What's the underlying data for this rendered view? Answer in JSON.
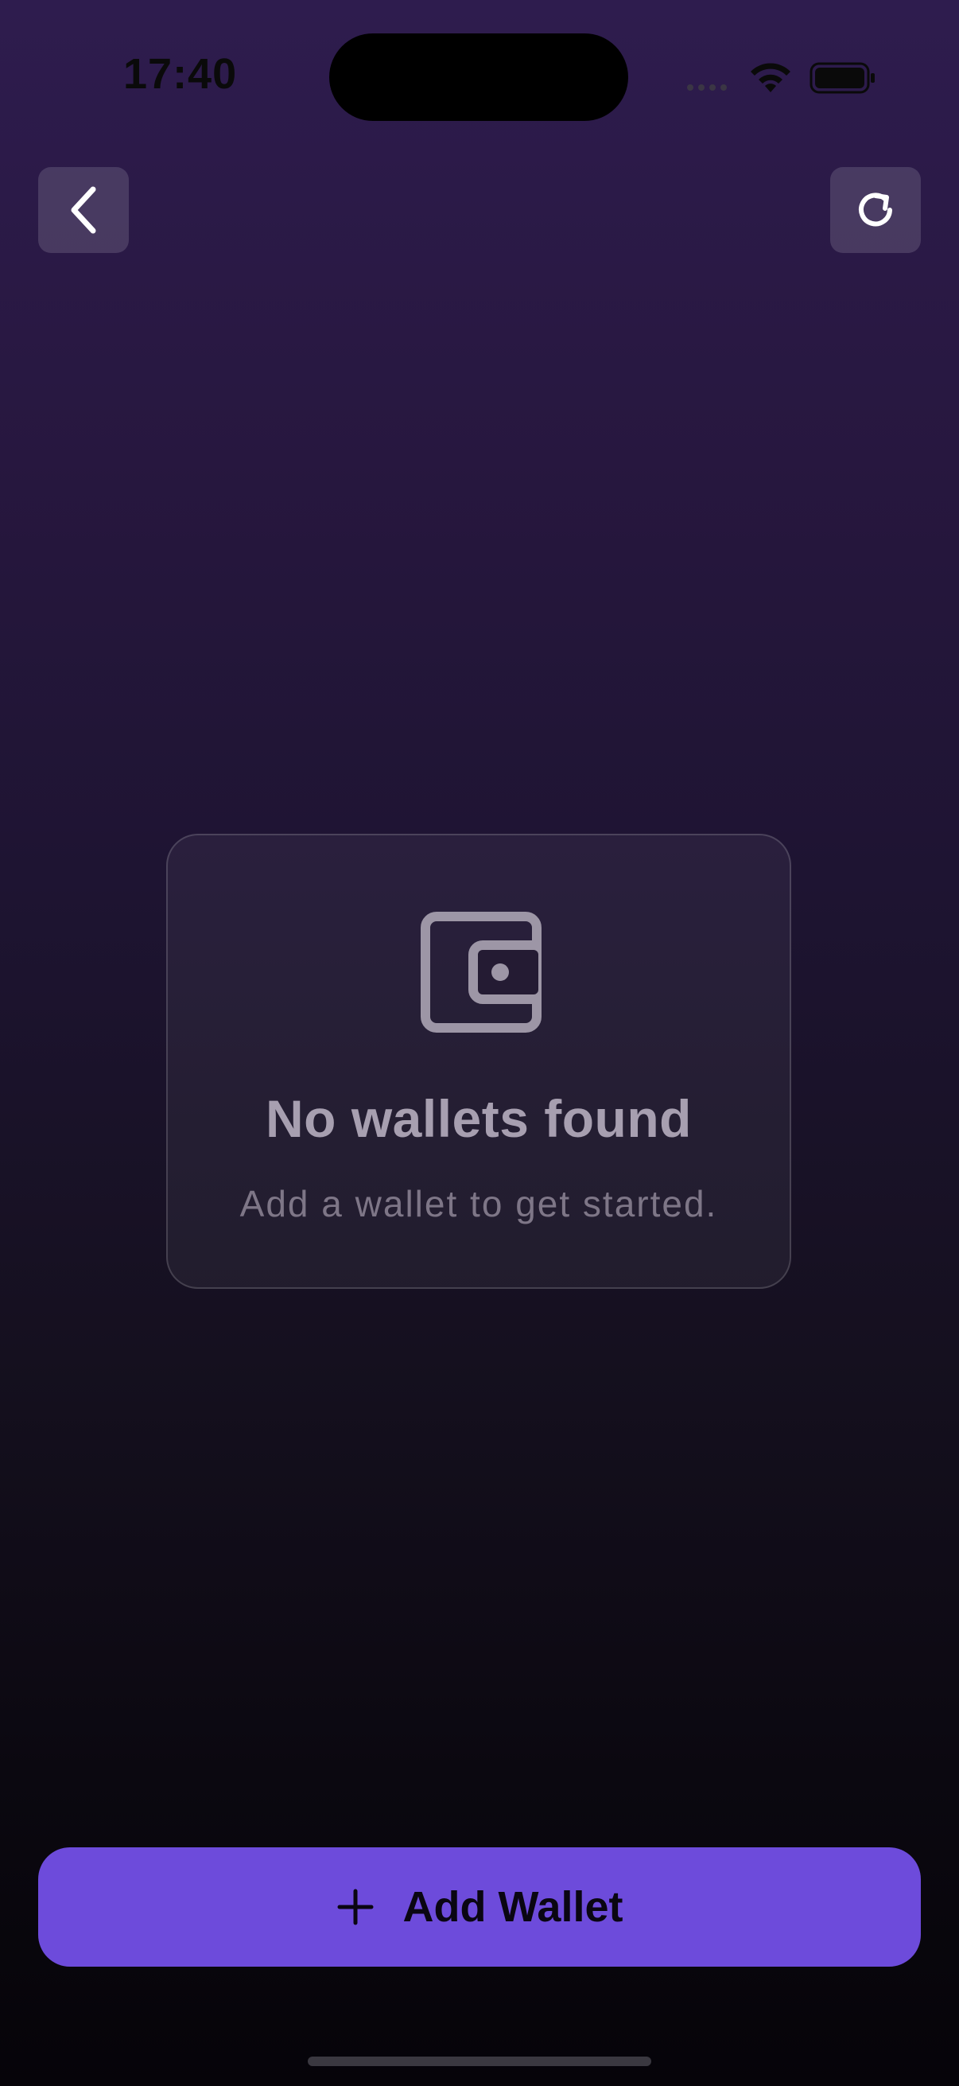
{
  "status_bar": {
    "time": "17:40"
  },
  "empty_state": {
    "title": "No wallets found",
    "subtitle": "Add a wallet to get started.",
    "icon": "wallet-icon"
  },
  "actions": {
    "back_icon": "chevron-left-icon",
    "refresh_icon": "refresh-icon",
    "add_wallet_label": "Add Wallet",
    "add_wallet_icon": "plus-icon"
  },
  "colors": {
    "accent": "#6d4bdb",
    "background_top": "#2e1c4e",
    "background_bottom": "#060409"
  }
}
